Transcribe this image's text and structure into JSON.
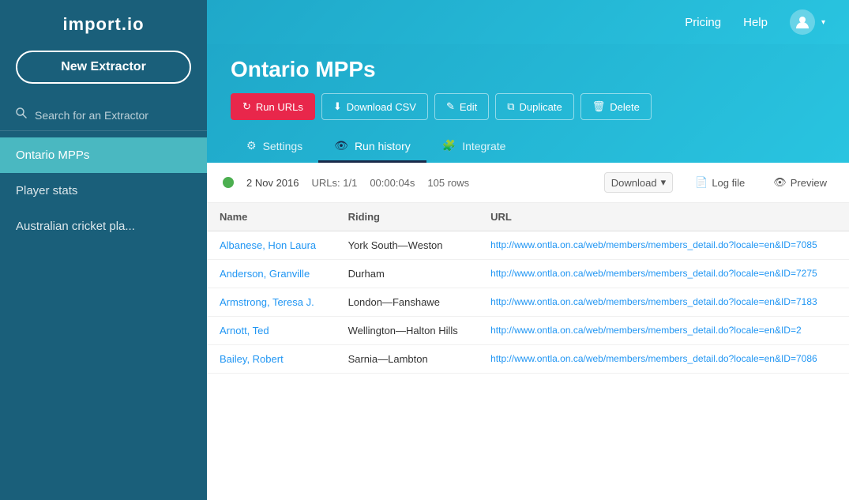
{
  "app": {
    "logo": "import.io"
  },
  "sidebar": {
    "new_extractor_label": "New Extractor",
    "search_placeholder": "Search for an Extractor",
    "nav_items": [
      {
        "id": "ontario-mpps",
        "label": "Ontario MPPs",
        "active": true
      },
      {
        "id": "player-stats",
        "label": "Player stats",
        "active": false
      },
      {
        "id": "australian-cricket",
        "label": "Australian cricket pla...",
        "active": false
      }
    ]
  },
  "topbar": {
    "pricing_label": "Pricing",
    "help_label": "Help"
  },
  "header": {
    "page_title": "Ontario MPPs",
    "toolbar": [
      {
        "id": "run-urls",
        "label": "Run URLs",
        "icon": "refresh",
        "primary": true
      },
      {
        "id": "download-csv",
        "label": "Download CSV",
        "icon": "download"
      },
      {
        "id": "edit",
        "label": "Edit",
        "icon": "pencil"
      },
      {
        "id": "duplicate",
        "label": "Duplicate",
        "icon": "copy"
      },
      {
        "id": "delete",
        "label": "Delete",
        "icon": "trash"
      }
    ],
    "tabs": [
      {
        "id": "settings",
        "label": "Settings",
        "icon": "gear",
        "active": false
      },
      {
        "id": "run-history",
        "label": "Run history",
        "icon": "eye",
        "active": true
      },
      {
        "id": "integrate",
        "label": "Integrate",
        "icon": "puzzle",
        "active": false
      }
    ]
  },
  "run_history": {
    "run": {
      "date": "2 Nov 2016",
      "urls": "URLs: 1/1",
      "duration": "00:00:04s",
      "rows": "105 rows",
      "download_label": "Download",
      "log_file_label": "Log file",
      "preview_label": "Preview"
    },
    "table": {
      "columns": [
        "Name",
        "Riding",
        "URL"
      ],
      "rows": [
        {
          "name": "Albanese, Hon Laura",
          "riding": "York South—Weston",
          "url": "http://www.ontla.on.ca/web/members/members_detail.do?locale=en&amp;ID=7085"
        },
        {
          "name": "Anderson, Granville",
          "riding": "Durham",
          "url": "http://www.ontla.on.ca/web/members/members_detail.do?locale=en&amp;ID=7275"
        },
        {
          "name": "Armstrong, Teresa J.",
          "riding": "London—Fanshawe",
          "url": "http://www.ontla.on.ca/web/members/members_detail.do?locale=en&amp;ID=7183"
        },
        {
          "name": "Arnott, Ted",
          "riding": "Wellington—Halton Hills",
          "url": "http://www.ontla.on.ca/web/members/members_detail.do?locale=en&amp;ID=2"
        },
        {
          "name": "Bailey, Robert",
          "riding": "Sarnia—Lambton",
          "url": "http://www.ontla.on.ca/web/members/members_detail.do?locale=en&amp;ID=7086"
        }
      ]
    }
  },
  "icons": {
    "refresh": "↻",
    "download": "⬇",
    "pencil": "✎",
    "copy": "⧉",
    "trash": "🗑",
    "gear": "⚙",
    "eye": "👁",
    "puzzle": "🧩",
    "search": "🔍",
    "logfile": "📄",
    "preview_eye": "👁",
    "chevron_down": "▾"
  },
  "colors": {
    "sidebar_bg": "#1a5f7a",
    "active_item_bg": "#4ab8c1",
    "topbar_gradient_start": "#1fa8c9",
    "topbar_gradient_end": "#29c4e0",
    "primary_btn": "#e8274b",
    "link_color": "#2196f3",
    "success_green": "#4caf50"
  }
}
